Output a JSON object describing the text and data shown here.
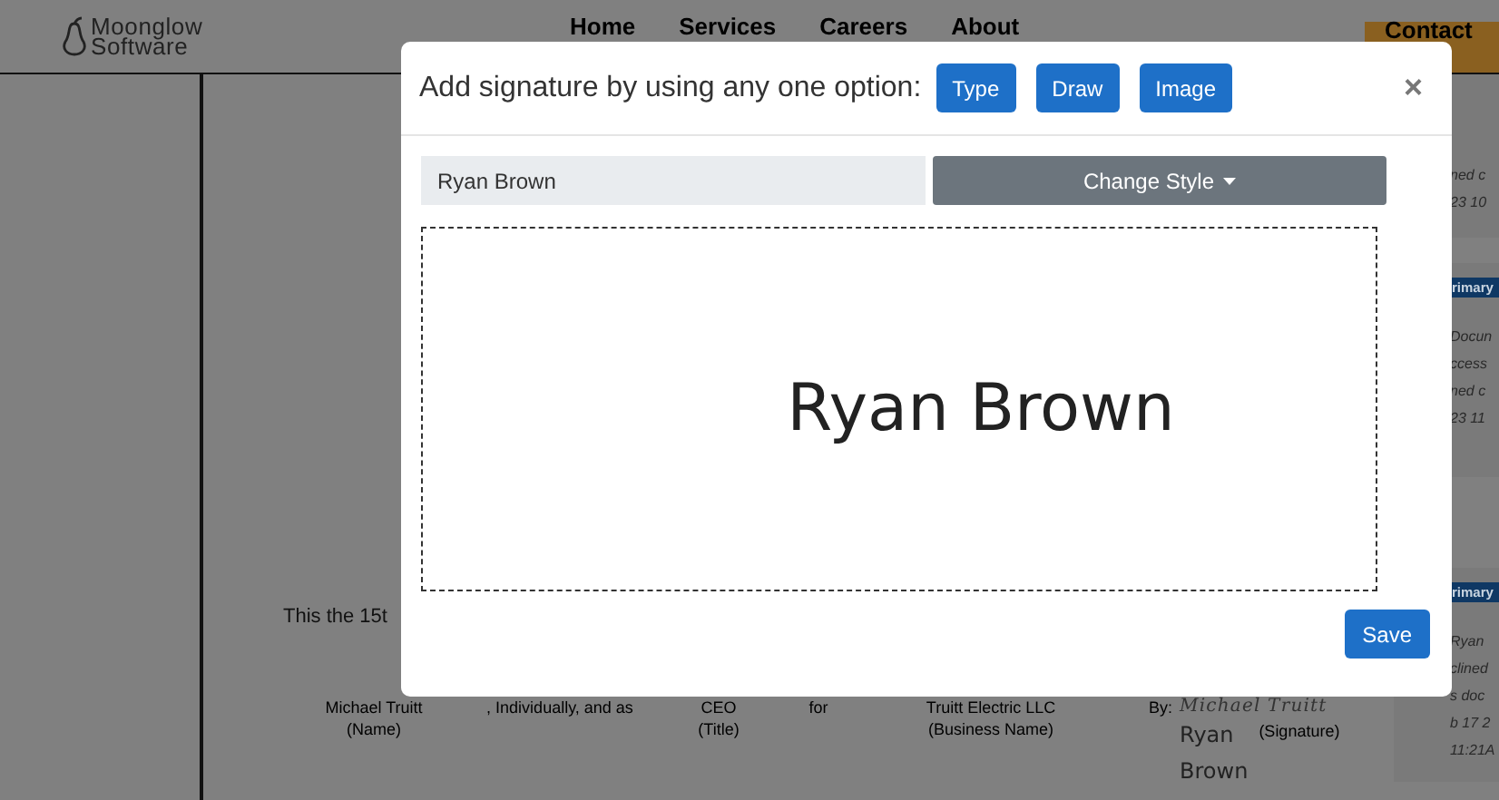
{
  "site_header": {
    "logo_lines": [
      "Moonglow",
      "Software"
    ],
    "nav": [
      "Home",
      "Services",
      "Careers",
      "About"
    ],
    "contact_button": "Contact"
  },
  "document": {
    "date_line": "This the 15t",
    "signature_row": [
      {
        "value": "Michael Truitt",
        "caption": "(Name)"
      },
      {
        "value": ", Individually, and as"
      },
      {
        "value": "CEO",
        "caption": "(Title)"
      },
      {
        "value": "for"
      },
      {
        "value": "Truitt Electric LLC",
        "caption": "(Business Name)"
      }
    ],
    "by_label": "By:",
    "signature": "Michael Truitt",
    "signature_caption": "(Signature)",
    "typed_signature": [
      "Ryan",
      "Brown"
    ]
  },
  "activity_sidebar": [
    {
      "lines": [
        "ned c",
        "23 10"
      ]
    },
    {
      "badge": "rimary",
      "lines": [
        "Docun",
        "ccess",
        "ned c",
        "23 11"
      ]
    },
    {
      "badge": "rimary",
      "lines": [
        "Ryan",
        "clined",
        "s doc",
        "b 17 2",
        "11:21A"
      ]
    }
  ],
  "modal": {
    "title": "Add signature by using any one option:",
    "options": [
      "Type",
      "Draw",
      "Image"
    ],
    "close": "×",
    "name_field": {
      "value": "Ryan Brown"
    },
    "style_button": "Change Style",
    "preview": "Ryan Brown",
    "save_button": "Save"
  }
}
